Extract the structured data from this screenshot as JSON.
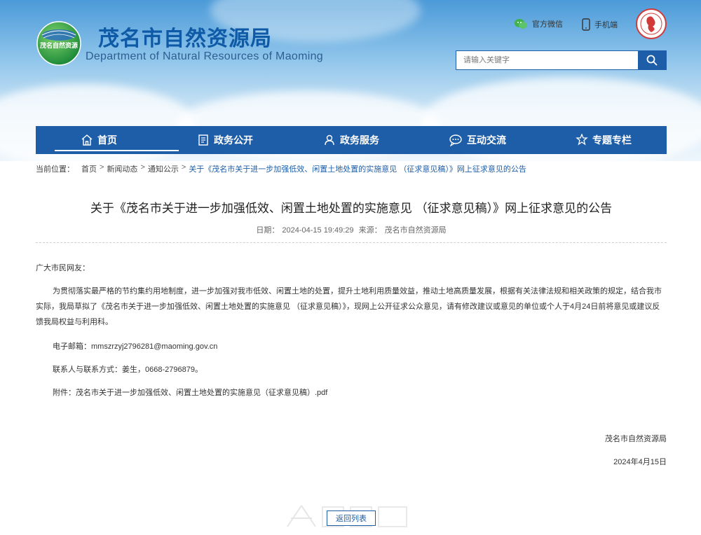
{
  "site": {
    "title": "茂名市自然资源局",
    "subtitle": "Department of Natural Resources of Maoming",
    "logo_text": "茂名自然资源"
  },
  "top_links": {
    "wechat": "官方微信",
    "mobile": "手机端"
  },
  "search": {
    "placeholder": "请输入关键字"
  },
  "nav": {
    "items": [
      {
        "label": "首页",
        "icon": "home-icon"
      },
      {
        "label": "政务公开",
        "icon": "document-icon"
      },
      {
        "label": "政务服务",
        "icon": "service-person-icon"
      },
      {
        "label": "互动交流",
        "icon": "chat-icon"
      },
      {
        "label": "专题专栏",
        "icon": "feature-icon"
      }
    ]
  },
  "breadcrumb": {
    "prefix": "当前位置：",
    "items": [
      "首页",
      "新闻动态",
      "通知公示"
    ],
    "separator": ">",
    "current": "关于《茂名市关于进一步加强低效、闲置土地处置的实施意见 （征求意见稿）》网上征求意见的公告"
  },
  "article": {
    "title": "关于《茂名市关于进一步加强低效、闲置土地处置的实施意见 （征求意见稿）》网上征求意见的公告",
    "date_label": "日期：",
    "date": "2024-04-15 19:49:29",
    "source_label": "来源：",
    "source": "茂名市自然资源局",
    "greeting": "广大市民网友：",
    "body": "为贯彻落实最严格的节约集约用地制度，进一步加强对我市低效、闲置土地的处置，提升土地利用质量效益，推动土地高质量发展，根据有关法律法规和相关政策的规定，结合我市实际，我局草拟了《茂名市关于进一步加强低效、闲置土地处置的实施意见 （征求意见稿）》，现网上公开征求公众意见，请有修改建议或意见的单位或个人于4月24日前将意见或建议反馈我局权益与利用科。",
    "email": "电子邮箱：mmszrzyj2796281@maoming.gov.cn",
    "contact": "联系人与联系方式：姜生，0668-2796879。",
    "attachment_label": "附件：",
    "attachment_file": "茂名市关于进一步加强低效、闲置土地处置的实施意见（征求意见稿）.pdf",
    "signature": "茂名市自然资源局",
    "sign_date": "2024年4月15日"
  },
  "back_button": "返回列表",
  "colors": {
    "primary": "#1e5ea8",
    "title_blue": "#0f5aa6"
  }
}
